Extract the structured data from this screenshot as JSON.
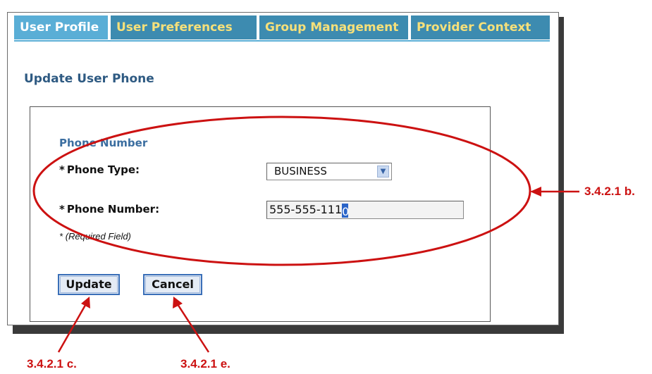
{
  "tabs": [
    {
      "label": "User Profile",
      "active": true
    },
    {
      "label": "User Preferences",
      "active": false
    },
    {
      "label": "Group Management",
      "active": false
    },
    {
      "label": "Provider Context",
      "active": false
    }
  ],
  "page_heading": "Update User Phone",
  "form": {
    "section_title": "Phone Number",
    "phone_type_label": "Phone Type:",
    "phone_type_value": "BUSINESS",
    "phone_number_label": "Phone Number:",
    "phone_number_value": "555-555-1110",
    "required_star": "*",
    "required_note": "(Required Field)",
    "update_label": "Update",
    "cancel_label": "Cancel"
  },
  "annotations": {
    "form_callout": "3.4.2.1 b.",
    "update_callout": "3.4.2.1 c.",
    "cancel_callout": "3.4.2.1 e."
  },
  "colors": {
    "tab_active": "#5aaed6",
    "tab_inactive": "#3d8bb0",
    "tab_inactive_text": "#f6e07a",
    "annotation_red": "#cc1111",
    "heading_blue": "#2e5a82"
  }
}
